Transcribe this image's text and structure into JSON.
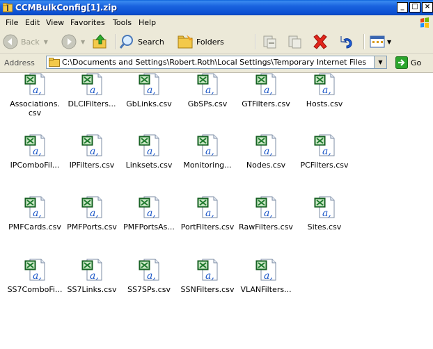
{
  "window": {
    "title": "CCMBulkConfig[1].zip",
    "buttons": [
      "_",
      "□",
      "×"
    ]
  },
  "menu": [
    "File",
    "Edit",
    "View",
    "Favorites",
    "Tools",
    "Help"
  ],
  "toolbar": {
    "back": "Back",
    "search": "Search",
    "folders": "Folders"
  },
  "address": {
    "label": "Address",
    "path": "C:\\Documents and Settings\\Robert.Roth\\Local Settings\\Temporary Internet Files",
    "go": "Go"
  },
  "files": [
    "Associations.csv",
    "DLCIFilters...",
    "GbLinks.csv",
    "GbSPs.csv",
    "GTFilters.csv",
    "Hosts.csv",
    "IPComboFil...",
    "IPFilters.csv",
    "Linksets.csv",
    "Monitoring...",
    "Nodes.csv",
    "PCFilters.csv",
    "PMFCards.csv",
    "PMFPorts.csv",
    "PMFPortsAs...",
    "PortFilters.csv",
    "RawFilters.csv",
    "Sites.csv",
    "SS7ComboFi...",
    "SS7Links.csv",
    "SS7SPs.csv",
    "SSNFilters.csv",
    "VLANFilters..."
  ],
  "icons": {
    "file": "excel-csv-icon",
    "folder": "folder-icon"
  },
  "colors": {
    "titlebar": "#0b4fd1",
    "chrome": "#ece9d8",
    "excel": "#1f7a2e"
  }
}
